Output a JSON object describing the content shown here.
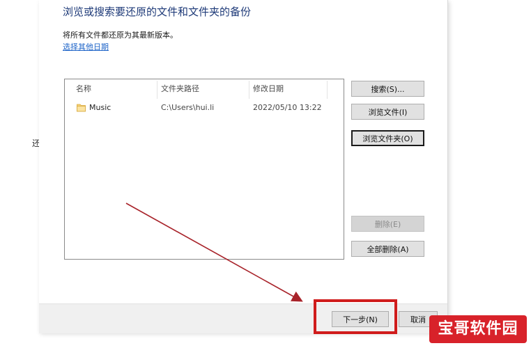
{
  "side_text": "还",
  "dialog": {
    "heading": "浏览或搜索要还原的文件和文件夹的备份",
    "subtext": "将所有文件都还原为其最新版本。",
    "link": "选择其他日期"
  },
  "file_list": {
    "columns": [
      "名称",
      "文件夹路径",
      "修改日期"
    ],
    "rows": [
      {
        "name": "Music",
        "path": "C:\\Users\\hui.li",
        "modified": "2022/05/10 13:22",
        "icon": "folder-icon"
      }
    ]
  },
  "buttons": {
    "search": "搜索(S)...",
    "browse_files": "浏览文件(I)",
    "browse_folders": "浏览文件夹(O)",
    "remove": "删除(E)",
    "remove_all": "全部删除(A)"
  },
  "footer": {
    "next": "下一步(N)",
    "cancel": "取消"
  },
  "watermark": "宝哥软件园",
  "colors": {
    "heading": "#1e3a78",
    "link": "#1e64c8",
    "annotation": "#d01c1c",
    "watermark_bg": "#d8222a"
  }
}
